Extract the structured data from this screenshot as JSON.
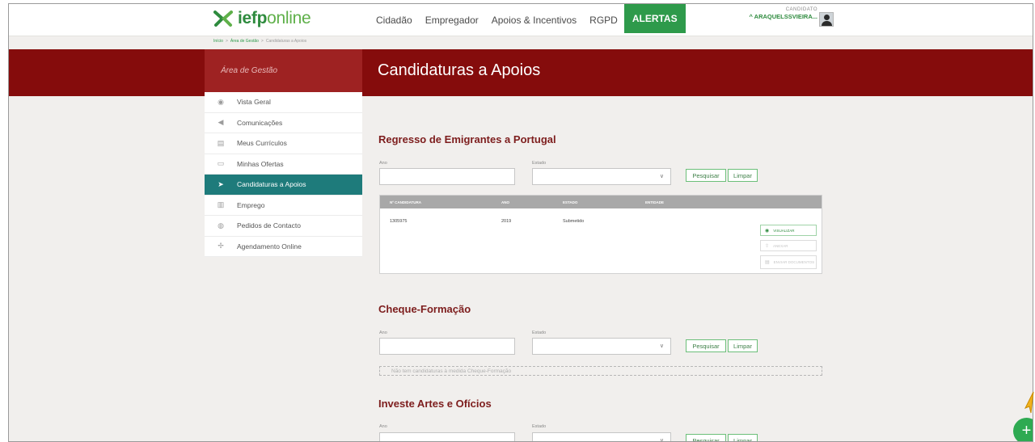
{
  "brand": {
    "name_bold": "iefp",
    "name_light": "online"
  },
  "nav": {
    "items": [
      "Cidadão",
      "Empregador",
      "Apoios & Incentivos",
      "RGPD"
    ],
    "alert": "ALERTAS"
  },
  "user": {
    "role": "CANDIDATO",
    "name": "ARAQUELSSVIEIRA..."
  },
  "breadcrumb": {
    "items": [
      "Início",
      ">",
      "Área de Gestão",
      ">",
      "Candidaturas a Apoios"
    ]
  },
  "band": {
    "area_label": "Área de Gestão",
    "page_title": "Candidaturas a Apoios"
  },
  "sidebar": {
    "items": [
      {
        "label": "Vista Geral",
        "icon": "eye-icon"
      },
      {
        "label": "Comunicações",
        "icon": "megaphone-icon"
      },
      {
        "label": "Meus Currículos",
        "icon": "document-icon"
      },
      {
        "label": "Minhas Ofertas",
        "icon": "briefcase-icon"
      },
      {
        "label": "Candidaturas a Apoios",
        "icon": "send-icon",
        "active": true
      },
      {
        "label": "Emprego",
        "icon": "bar-chart-icon"
      },
      {
        "label": "Pedidos de Contacto",
        "icon": "chat-icon"
      },
      {
        "label": "Agendamento Online",
        "icon": "pin-icon"
      }
    ]
  },
  "sections": [
    {
      "title": "Regresso de Emigrantes a Portugal",
      "ano_label": "Ano",
      "estado_label": "Estado",
      "search_label": "Pesquisar",
      "clear_label": "Limpar",
      "table": {
        "headers": [
          "Nº CANDIDATURA",
          "ANO",
          "ESTADO",
          "ENTIDADE"
        ],
        "rows": [
          {
            "candidatura": "1305975",
            "ano": "2019",
            "estado": "Submetido",
            "entidade": ""
          }
        ],
        "actions": [
          "VISUALIZAR",
          "ANEXAR",
          "ENVIAR DOCUMENTOS"
        ]
      }
    },
    {
      "title": "Cheque-Formação",
      "ano_label": "Ano",
      "estado_label": "Estado",
      "search_label": "Pesquisar",
      "clear_label": "Limpar",
      "empty_text": "Não tem candidaturas à medida Cheque-Formação"
    },
    {
      "title": "Investe Artes e Ofícios",
      "ano_label": "Ano",
      "estado_label": "Estado",
      "search_label": "Pesquisar",
      "clear_label": "Limpar"
    }
  ],
  "fab": {
    "label": "+"
  },
  "colors": {
    "primary_red": "#850c0c",
    "accent_green": "#2e9a4b",
    "active_teal": "#1e7b7b"
  }
}
